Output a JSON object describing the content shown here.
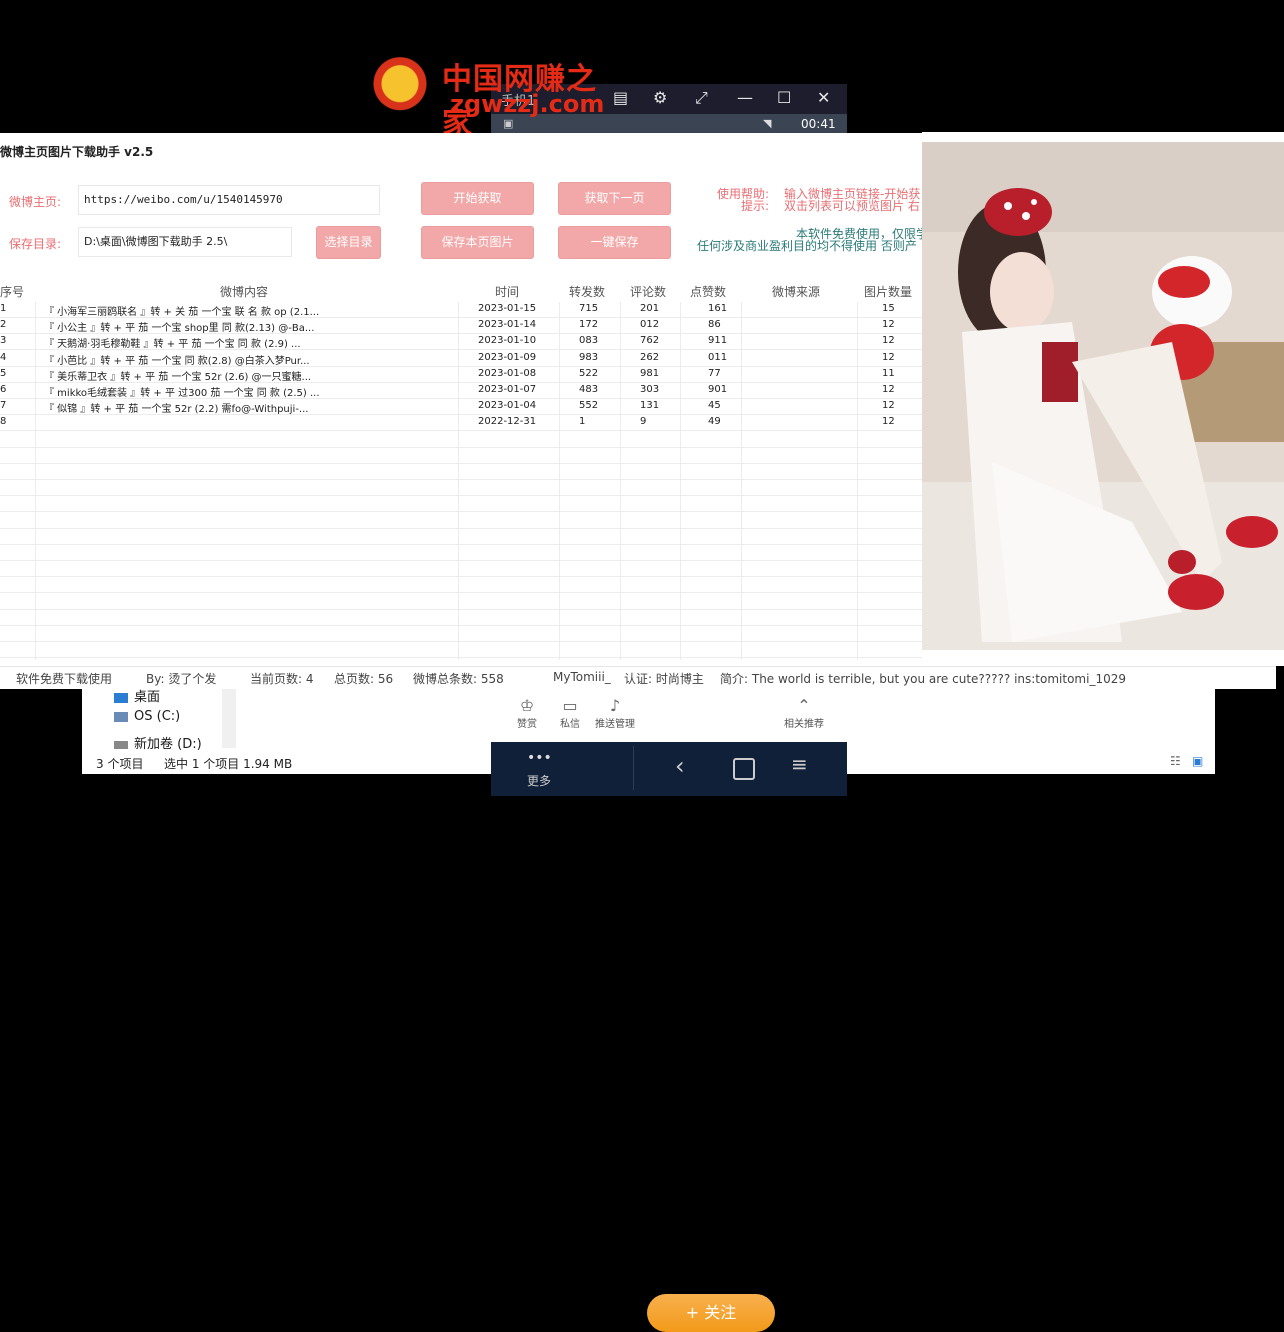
{
  "explorer": {
    "tree_items": [
      {
        "icon": "desktop-icon",
        "label": "桌面"
      },
      {
        "icon": "drive-icon",
        "label": "OS (C:)"
      },
      {
        "icon": "drive-icon",
        "label": "新加卷 (D:)"
      }
    ],
    "status_count": "3 个项目",
    "status_selected": "选中 1 个项目  1.94 MB"
  },
  "phone": {
    "window_title": "手机1",
    "clock": "00:41",
    "toolbar_icons": [
      "chat-icon",
      "gear-icon",
      "fullscreen-icon",
      "minimize-icon",
      "maximize-icon",
      "close-icon"
    ],
    "actions": [
      {
        "icon": "reward-icon",
        "label": "赞赏"
      },
      {
        "icon": "message-icon",
        "label": "私信"
      },
      {
        "icon": "push-icon",
        "label": "推送管理"
      },
      {
        "icon": "related-icon",
        "label": "相关推荐"
      }
    ],
    "follow_label": "+ 关注",
    "more_label": "更多"
  },
  "logo": {
    "line1": "中国网赚之家",
    "line2": "zgwzzj.com",
    "color": "#e52b16"
  },
  "app": {
    "title": "微博主页图片下载助手 v2.5",
    "homepage_label": "微博主页:",
    "homepage_value": "https://weibo.com/u/1540145970",
    "savedir_label": "保存目录:",
    "savedir_value": "D:\\桌面\\微博图下载助手 2.5\\",
    "btn_fetch": "开始获取",
    "btn_next": "获取下一页",
    "btn_choose_dir": "选择目录",
    "btn_save_page": "保存本页图片",
    "btn_one_click": "一键保存",
    "help_label": "使用帮助:",
    "help_text": "输入微博主页链接-开始获",
    "tip_label": "提示:",
    "tip_text": "双击列表可以预览图片  右",
    "notice1": "本软件免费使用，仅限学",
    "notice2": "任何涉及商业盈利目的均不得使用  否则产",
    "accent": "#f2a8a8",
    "columns": [
      "序号",
      "微博内容",
      "时间",
      "转发数",
      "评论数",
      "点赞数",
      "微博来源",
      "图片数量"
    ],
    "rows": [
      [
        "1",
        "『  小海军三丽鸥联名  』转 + 关        茄 一个宝 联 名 款 op (2.1...",
        "2023-01-15",
        "715",
        "201",
        "161",
        "",
        "15"
      ],
      [
        "2",
        "『  小公主   』转 + 平          茄 一个宝  shop里 同 款(2.13) @-Ba...",
        "2023-01-14",
        "172",
        "012",
        "86",
        "",
        "12"
      ],
      [
        "3",
        "『  天鹅湖·羽毛穆勒鞋    』转 + 平        茄 一个宝  同 款 (2.9) ...",
        "2023-01-10",
        "083",
        "762",
        "911",
        "",
        "12"
      ],
      [
        "4",
        "『  小芭比   』转 + 平          茄 一个宝  同 款(2.8)  @白茶入梦Pur...",
        "2023-01-09",
        "983",
        "262",
        "011",
        "",
        "12"
      ],
      [
        "5",
        "『  美乐蒂卫衣   』转 + 平        茄 一个宝  52r (2.6)  @一只蜜糖...",
        "2023-01-08",
        "522",
        "981",
        "77",
        "",
        "11"
      ],
      [
        "6",
        "『  mikko毛绒套装   』转 + 平        过300  茄 一个宝  同 款 (2.5) ...",
        "2023-01-07",
        "483",
        "303",
        "901",
        "",
        "12"
      ],
      [
        "7",
        "『  似锦    』转 + 平          茄 一个宝  52r (2.2)  需fo@-Withpuji-...",
        "2023-01-04",
        "552",
        "131",
        "45",
        "",
        "12"
      ],
      [
        "8",
        "",
        "2022-12-31",
        "1",
        "9",
        "49",
        "",
        "12"
      ]
    ],
    "status": {
      "free": "软件免费下载使用",
      "by": "By: 烫了个发",
      "current_page": "当前页数: 4",
      "total_pages": "总页数: 56",
      "total_posts": "微博总条数: 558",
      "user": "MyTomiii_",
      "verified": "认证: 时尚博主",
      "bio": "简介: The world is terrible, but you are cute????? ins:tomitomi_1029"
    }
  }
}
